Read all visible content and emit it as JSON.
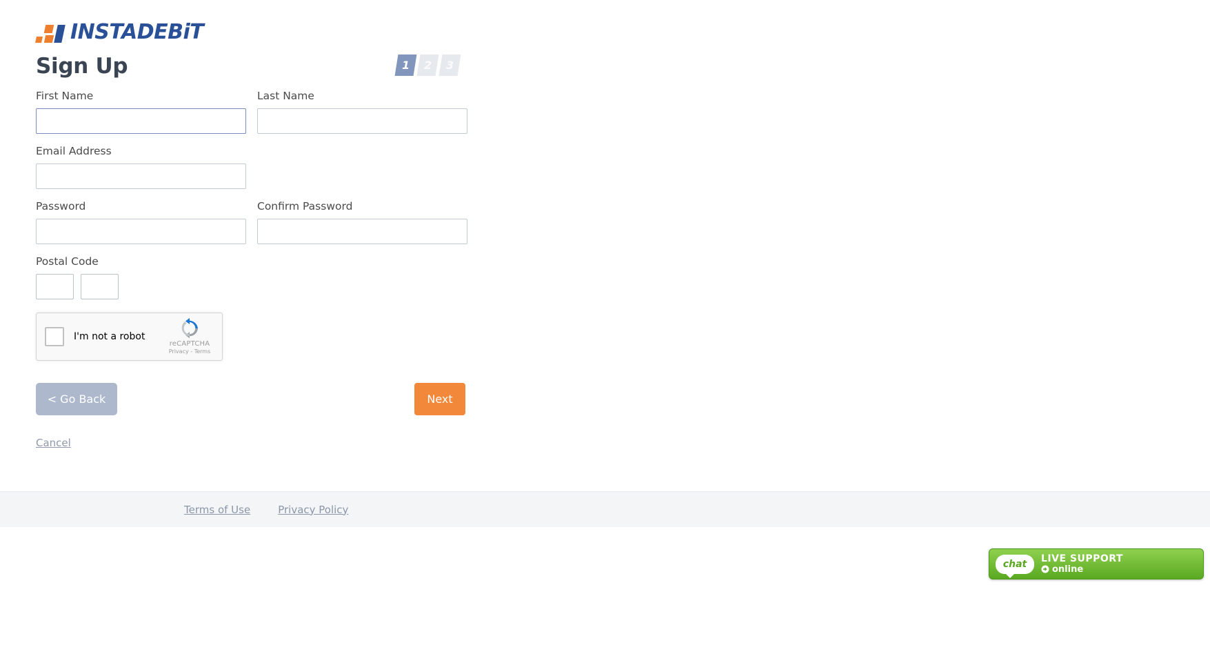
{
  "brand": {
    "logo_text_upper": "INSTADEB",
    "logo_text_lower": "i",
    "logo_text_end": "T",
    "logo_full": "INSTADEBiT",
    "orange": "#ee7f2e",
    "blue": "#2a5197"
  },
  "header": {
    "title": "Sign Up"
  },
  "steps": [
    {
      "label": "1",
      "state": "active"
    },
    {
      "label": "2",
      "state": "inactive"
    },
    {
      "label": "3",
      "state": "inactive"
    }
  ],
  "form": {
    "first_name": {
      "label": "First Name",
      "value": "",
      "placeholder": ""
    },
    "last_name": {
      "label": "Last Name",
      "value": "",
      "placeholder": ""
    },
    "email": {
      "label": "Email Address",
      "value": "",
      "placeholder": ""
    },
    "password": {
      "label": "Password",
      "value": "",
      "placeholder": ""
    },
    "confirm_password": {
      "label": "Confirm Password",
      "value": "",
      "placeholder": ""
    },
    "postal_code": {
      "label": "Postal Code",
      "part1": "",
      "part2": ""
    }
  },
  "recaptcha": {
    "checkbox_label": "I'm not a robot",
    "brand": "reCAPTCHA",
    "privacy": "Privacy",
    "separator": "-",
    "terms": "Terms"
  },
  "actions": {
    "back_label": "< Go Back",
    "next_label": "Next",
    "cancel_label": "Cancel",
    "next_color": "#f1883a",
    "back_color": "#adb8cc"
  },
  "footer": {
    "terms_of_use": "Terms of Use",
    "privacy_policy": "Privacy Policy"
  },
  "live_support": {
    "chat_label": "chat",
    "line1": "LIVE SUPPORT",
    "line2": "online",
    "color": "#5aa821"
  }
}
